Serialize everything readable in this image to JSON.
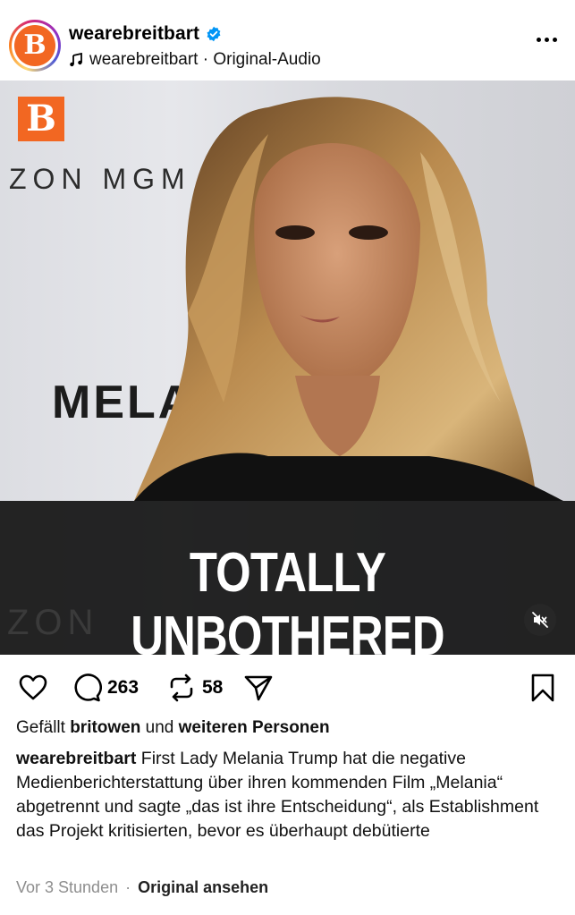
{
  "header": {
    "avatar_letter": "B",
    "username": "wearebreitbart",
    "audio_text": "wearebreitbart · Original-Audio"
  },
  "media": {
    "logo_letter": "B",
    "backdrop_line1": "ZON MGM",
    "backdrop_line2": "MELA",
    "backdrop_line3": "ZON",
    "caption": "TOTALLY UNBOTHERED"
  },
  "actions": {
    "comments_count": "263",
    "reposts_count": "58"
  },
  "likes": {
    "prefix": "Gefällt ",
    "user": "britowen",
    "middle": " und ",
    "others": "weiteren Personen"
  },
  "post": {
    "author": "wearebreitbart",
    "text": " First Lady Melania Trump hat die negative Medienberichterstattung über ihren kommenden Film „Melania“ abgetrennt und sagte „das ist ihre Entscheidung“, als Establishment das Projekt kritisierten, bevor es überhaupt debütierte"
  },
  "meta": {
    "time": "Vor 3 Stunden",
    "separator": "·",
    "view_original": "Original ansehen"
  },
  "colors": {
    "brand": "#f26722",
    "verified": "#0095f6",
    "muted_text": "#8e8e8e"
  }
}
